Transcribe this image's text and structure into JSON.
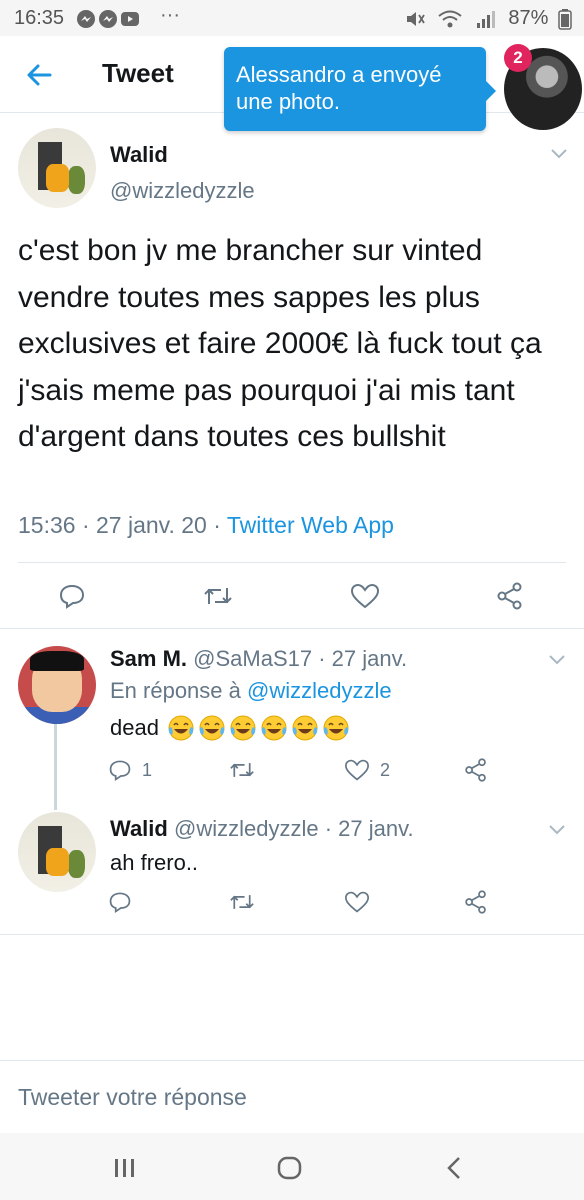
{
  "status_bar": {
    "time": "16:35",
    "battery": "87%",
    "app_icons": [
      "messenger-icon",
      "messenger-icon",
      "youtube-icon"
    ],
    "more": "···"
  },
  "header": {
    "title": "Tweet",
    "back_icon": "back-arrow-icon"
  },
  "notification": {
    "text": "Alessandro a envoyé une photo.",
    "badge_count": "2"
  },
  "main_tweet": {
    "name": "Walid",
    "handle": "@wizzledyzzle",
    "text": "c'est bon jv me brancher sur vinted vendre toutes mes sappes les plus exclusives et faire 2000€ là fuck tout ça j'sais meme pas pourquoi j'ai mis tant d'argent dans toutes ces bullshit",
    "time": "15:36",
    "separator": "·",
    "date": "27 janv. 20",
    "source": "Twitter Web App"
  },
  "replies": [
    {
      "name": "Sam M.",
      "handle": "@SaMaS17",
      "date": "· 27 janv.",
      "reply_prefix": "En réponse à",
      "reply_mention": "@wizzledyzzle",
      "text": "dead",
      "emoji_count": 6,
      "reply_count": "1",
      "like_count": "2"
    },
    {
      "name": "Walid",
      "handle": "@wizzledyzzle",
      "date": "· 27 janv.",
      "text": "ah frero..",
      "reply_count": "",
      "like_count": ""
    }
  ],
  "compose": {
    "placeholder": "Tweeter votre réponse"
  },
  "colors": {
    "accent": "#1b95e0",
    "secondary_text": "#657786",
    "divider": "#e1e8ed",
    "badge": "#e0245e"
  }
}
